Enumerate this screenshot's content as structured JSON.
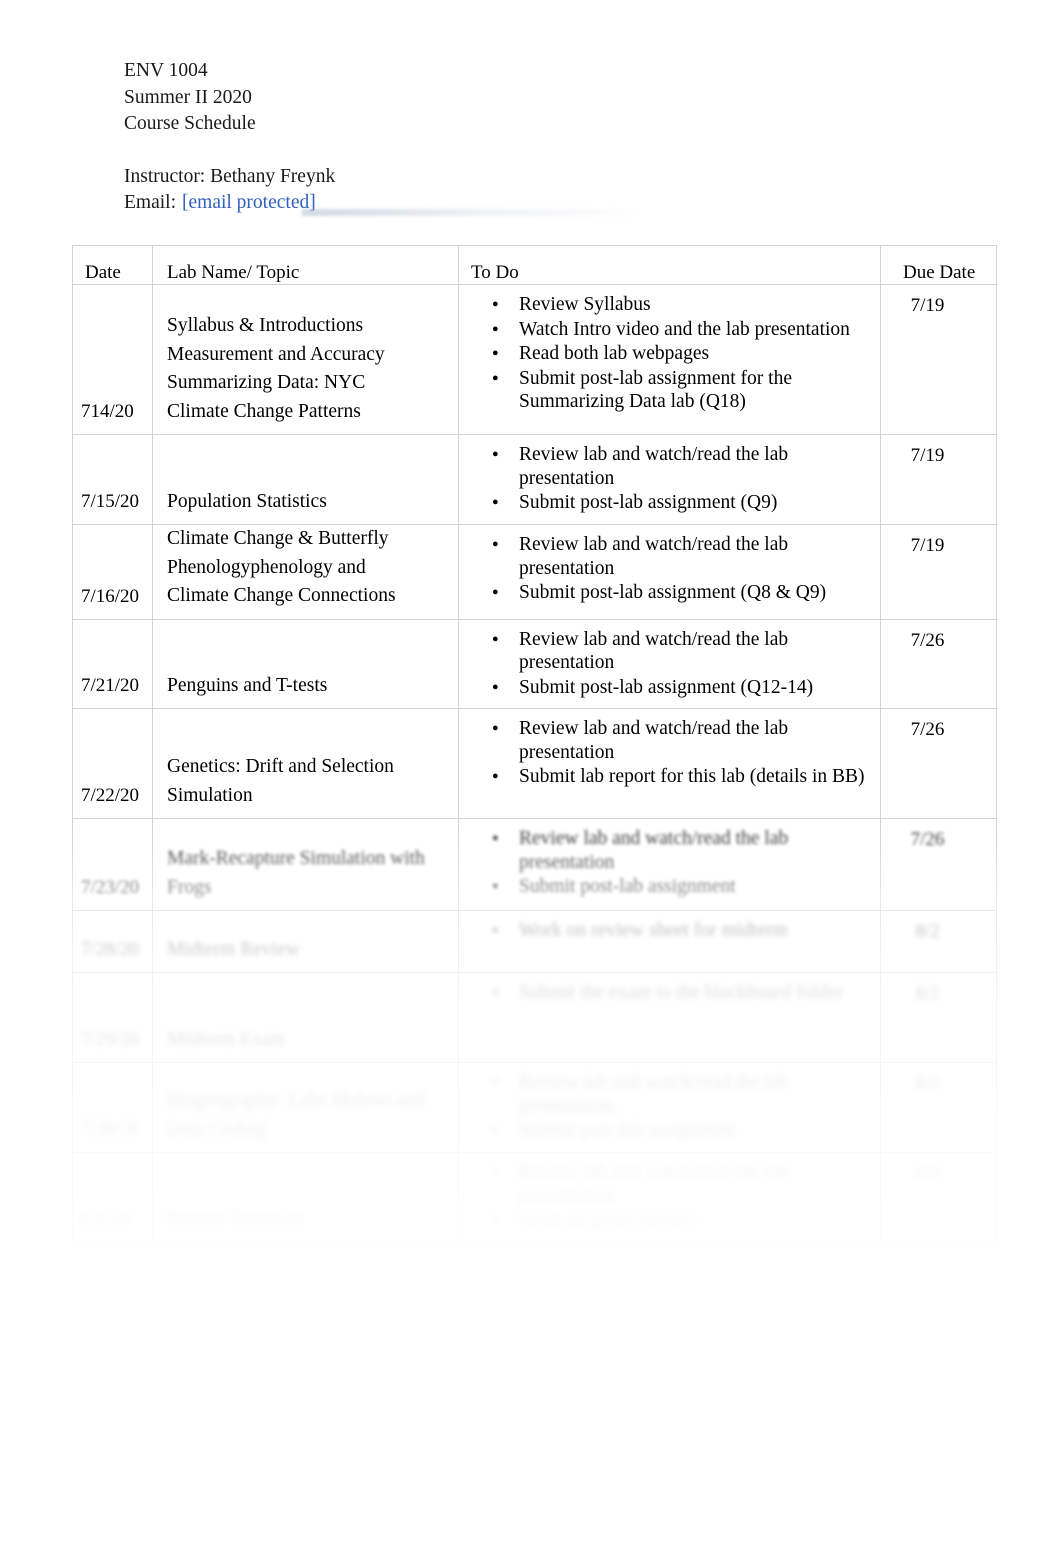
{
  "document": {
    "course_code": "ENV 1004",
    "term": "Summer II 2020",
    "doc_title": "Course Schedule",
    "instructor": "Instructor: Bethany Freynk",
    "email_label": "Email:",
    "email_value": "[email protected]",
    "link_color": "#2f5fc0"
  },
  "table": {
    "headers": {
      "date": "Date",
      "lab": "Lab Name/ Topic",
      "todo": "To Do",
      "due": "Due Date"
    },
    "rows": [
      {
        "date": "714/20",
        "lab": "Syllabus & Introductions Measurement and Accuracy Summarizing Data: NYC Climate Change Patterns",
        "lab_lines": [
          "Syllabus & Introductions",
          "Measurement and Accuracy",
          "Summarizing Data: NYC",
          "Climate Change Patterns"
        ],
        "todo": [
          "Review Syllabus",
          "Watch Intro video and the lab presentation",
          "Read both lab webpages",
          "Submit post-lab assignment for the Summarizing Data lab (Q18)"
        ],
        "due": "7/19",
        "legibility": "clear"
      },
      {
        "date": "7/15/20",
        "lab": "Population Statistics",
        "lab_lines": [
          "Population Statistics"
        ],
        "todo": [
          "Review lab and watch/read the lab presentation",
          "Submit post-lab assignment (Q9)"
        ],
        "due": "7/19",
        "legibility": "clear"
      },
      {
        "date": "7/16/20",
        "lab": "Climate Change & Butterfly Phenologyphenology and Climate Change Connections",
        "lab_lines": [
          "Climate Change & Butterfly",
          "Phenologyphenology and",
          "Climate Change Connections"
        ],
        "todo": [
          "Review lab and watch/read the lab presentation",
          "Submit post-lab assignment (Q8 & Q9)"
        ],
        "due": "7/19",
        "legibility": "clear"
      },
      {
        "date": "7/21/20",
        "lab": "Penguins and T-tests",
        "lab_lines": [
          "Penguins and T-tests"
        ],
        "todo": [
          "Review lab and watch/read the lab presentation",
          "Submit post-lab assignment (Q12-14)"
        ],
        "due": "7/26",
        "legibility": "clear"
      },
      {
        "date": "7/22/20",
        "lab": "Genetics: Drift and Selection Simulation",
        "lab_lines": [
          "Genetics: Drift and Selection",
          "Simulation"
        ],
        "todo": [
          "Review lab and watch/read the lab presentation",
          "Submit  lab report    for this lab (details in BB)"
        ],
        "due": "7/26",
        "legibility": "clear"
      },
      {
        "date": "7/23/20",
        "lab": "Mark-Recapture Simulation with Frogs",
        "lab_lines": [
          "Mark-Recapture Simulation with",
          "Frogs"
        ],
        "todo": [
          "Review lab and watch/read the lab presentation",
          "Submit post-lab assignment"
        ],
        "due": "7/26",
        "legibility": "partially-faded"
      },
      {
        "date": "7/28/20",
        "lab": "Midterm Review",
        "lab_lines": [
          "Midterm Review"
        ],
        "todo": [
          "Work on review sheet for midterm"
        ],
        "due": "8/2",
        "legibility": "faded"
      },
      {
        "date": "7/29/20",
        "lab": "Midterm Exam",
        "lab_lines": [
          "Midterm Exam"
        ],
        "todo": [
          "Submit the exam to the blackboard folder"
        ],
        "due": "8/2",
        "legibility": "faded"
      },
      {
        "date": "7/30/20",
        "lab": "Biogeography: Lake Malawi and Data Coding",
        "lab_lines": [
          "Biogeography: Lake Malawi and",
          "Data Coding"
        ],
        "todo": [
          "Review lab and watch/read the lab presentation",
          "Submit post-lab assignment"
        ],
        "due": "8/2",
        "legibility": "faded"
      },
      {
        "date": "8/4/20",
        "lab": "Primate Behavior",
        "lab_lines": [
          "Primate Behavior"
        ],
        "todo": [
          "Review lab and watch/read the lab presentation",
          "Work on group project"
        ],
        "due": "8/9",
        "legibility": "faded"
      }
    ]
  }
}
